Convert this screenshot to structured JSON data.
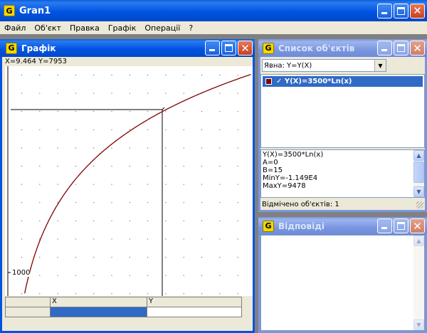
{
  "app": {
    "title": "Gran1",
    "icon": "app-logo-icon"
  },
  "menu": [
    "Файл",
    "Об'єкт",
    "Правка",
    "Графік",
    "Операції",
    "?"
  ],
  "graph_window": {
    "title": "Графік",
    "cursor_readout": "X=9.464  Y=7953",
    "y_tick_label": "1000",
    "table": {
      "col_x": "X",
      "col_y": "Y"
    }
  },
  "objects_window": {
    "title": "Список об'єктів",
    "mode_select": "Явна: Y=Y(X)",
    "items": [
      {
        "label": "✓ Y(X)=3500*Ln(x)",
        "color": "#800000"
      }
    ],
    "details": [
      "Y(X)=3500*Ln(x)",
      "A=0",
      "B=15",
      "MinY=-1.149E4",
      "MaxY=9478"
    ],
    "status": "Відмічено об'єктів: 1"
  },
  "answers_window": {
    "title": "Відповіді"
  },
  "chart_data": {
    "type": "line",
    "series": [
      {
        "name": "Y(X)=3500*Ln(x)",
        "function": "3500*ln(x)",
        "color": "#800000"
      }
    ],
    "x_range": [
      0,
      15
    ],
    "cursor": {
      "x": 9.464,
      "y": 7953
    },
    "grid": "dotted"
  }
}
